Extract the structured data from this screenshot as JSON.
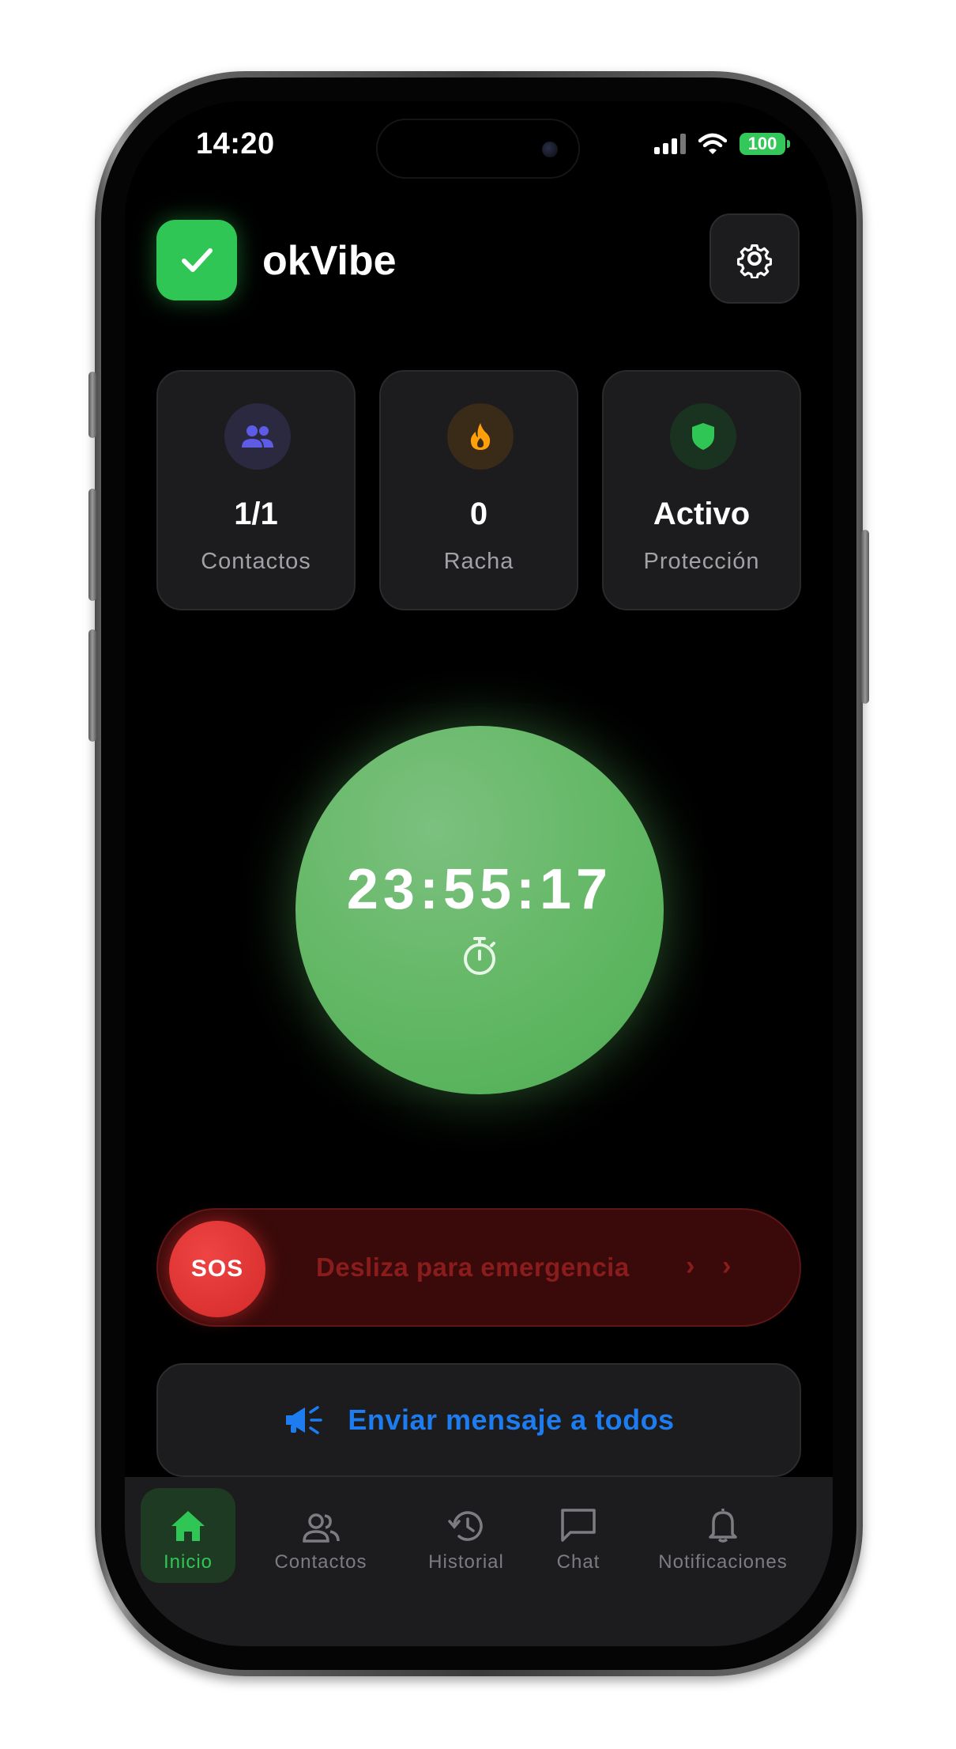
{
  "status_bar": {
    "time": "14:20",
    "battery": "100"
  },
  "header": {
    "app_name": "okVibe"
  },
  "stats": [
    {
      "value": "1/1",
      "label": "Contactos",
      "icon": "people-icon",
      "color": "#5e5ce6"
    },
    {
      "value": "0",
      "label": "Racha",
      "icon": "flame-icon",
      "color": "#ff9f0a"
    },
    {
      "value": "Activo",
      "label": "Protección",
      "icon": "shield-icon",
      "color": "#30c656"
    }
  ],
  "timer": {
    "value": "23:55:17",
    "icon": "stopwatch-icon"
  },
  "sos": {
    "knob_label": "SOS",
    "label": "Desliza para emergencia"
  },
  "broadcast": {
    "label": "Enviar mensaje a todos",
    "icon": "megaphone-icon"
  },
  "tabs": [
    {
      "label": "Inicio",
      "icon": "home-icon",
      "active": true
    },
    {
      "label": "Contactos",
      "icon": "people-icon",
      "active": false
    },
    {
      "label": "Historial",
      "icon": "history-icon",
      "active": false
    },
    {
      "label": "Chat",
      "icon": "chat-icon",
      "active": false
    },
    {
      "label": "Notificaciones",
      "icon": "bell-icon",
      "active": false
    }
  ],
  "colors": {
    "accent_green": "#30c656",
    "sos_red": "#e53935",
    "link_blue": "#1c7cf0",
    "card_bg": "#1c1c1e"
  }
}
